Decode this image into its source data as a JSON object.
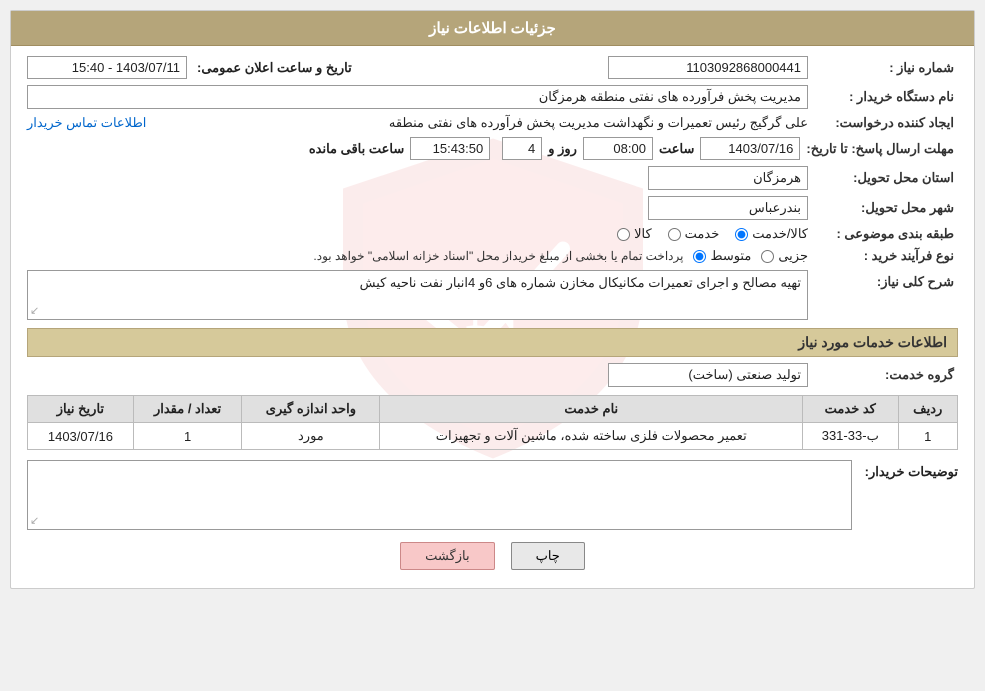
{
  "page": {
    "title": "جزئیات اطلاعات نیاز"
  },
  "header": {
    "title": "جزئیات اطلاعات نیاز"
  },
  "fields": {
    "shomareNiaz_label": "شماره نیاز :",
    "shomareNiaz_value": "1103092868000441",
    "namedastgah_label": "نام دستگاه خریدار :",
    "namedastgah_value": "مدیریت پخش فرآورده های نفتی منطقه هرمزگان",
    "ijadkonnde_label": "ایجاد کننده درخواست:",
    "ijadkonnde_value": "علی گرگیج رئیس تعمیرات و نگهداشت مدیریت پخش فرآورده های نفتی منطقه",
    "ijadkonnde_link": "اطلاعات تماس خریدار",
    "mohlat_label": "مهلت ارسال پاسخ: تا تاریخ:",
    "mohlat_date": "1403/07/16",
    "mohlat_time": "08:00",
    "mohlat_days": "4",
    "mohlat_remaining": "15:43:50",
    "mohlat_days_label": "روز و",
    "mohlat_remaining_label": "ساعت باقی مانده",
    "ostan_label": "استان محل تحویل:",
    "ostan_value": "هرمزگان",
    "shahr_label": "شهر محل تحویل:",
    "shahr_value": "بندرعباس",
    "tabaqe_label": "طبقه بندی موضوعی :",
    "tabaqe_kala": "کالا",
    "tabaqe_khadamat": "خدمت",
    "tabaqe_kala_khadamat": "کالا/خدمت",
    "nofarayand_label": "نوع فرآیند خرید :",
    "nofarayand_jozii": "جزیی",
    "nofarayand_mottaset": "متوسط",
    "nofarayand_note": "پرداخت تمام یا بخشی از مبلغ خریداز محل \"اسناد خزانه اسلامی\" خواهد بود.",
    "sharh_label": "شرح کلی نیاز:",
    "sharh_value": "تهیه مصالح و اجرای تعمیرات مکانیکال مخازن شماره های 6و 4انبار نفت ناحیه کیش",
    "khadamat_label": "اطلاعات خدمات مورد نیاز",
    "grohe_label": "گروه خدمت:",
    "grohe_value": "تولید صنعتی (ساخت)",
    "tarikhe_label": "تاریخ و ساعت اعلان عمومی:",
    "tarikhe_value": "1403/07/11 - 15:40"
  },
  "table": {
    "headers": [
      "ردیف",
      "کد خدمت",
      "نام خدمت",
      "واحد اندازه گیری",
      "تعداد / مقدار",
      "تاریخ نیاز"
    ],
    "rows": [
      {
        "radif": "1",
        "code": "ب-33-331",
        "name": "تعمیر محصولات فلزی ساخته شده، ماشین آلات و تجهیزات",
        "unit": "مورد",
        "count": "1",
        "date": "1403/07/16"
      }
    ]
  },
  "buyer_notes_label": "توضیحات خریدار:",
  "buttons": {
    "print": "چاپ",
    "back": "بازگشت"
  },
  "icons": {
    "resize": "↙"
  }
}
